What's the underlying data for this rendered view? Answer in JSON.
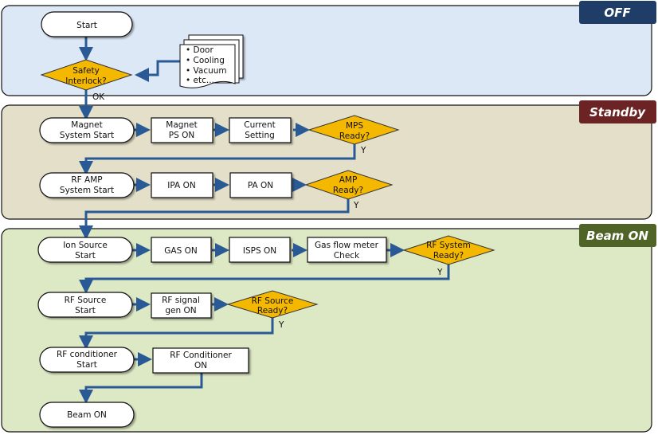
{
  "phases": [
    {
      "id": "off",
      "label": "OFF",
      "bg": "#dde8f7",
      "badge_color": "#1f3d66"
    },
    {
      "id": "standby",
      "label": "Standby",
      "bg": "#e3dfc8",
      "badge_color": "#6b2323"
    },
    {
      "id": "beam",
      "label": "Beam ON",
      "bg": "#dde8c4",
      "badge_color": "#4f6426"
    }
  ],
  "nodes": {
    "start": [
      "Start"
    ],
    "safety": [
      "Safety",
      "Interlock?"
    ],
    "interlock_list": [
      "• Door",
      "• Cooling",
      "• Vacuum",
      "• etc..."
    ],
    "magnet_start": [
      "Magnet",
      "System Start"
    ],
    "magnet_ps": [
      "Magnet",
      "PS ON"
    ],
    "current_setting": [
      "Current",
      "Setting"
    ],
    "mps_ready": [
      "MPS",
      "Ready?"
    ],
    "rfamp_start": [
      "RF AMP",
      "System Start"
    ],
    "ipa_on": [
      "IPA ON"
    ],
    "pa_on": [
      "PA ON"
    ],
    "amp_ready": [
      "AMP",
      "Ready?"
    ],
    "ion_start": [
      "Ion Source",
      "Start"
    ],
    "gas_on": [
      "GAS ON"
    ],
    "isps_on": [
      "ISPS ON"
    ],
    "gasflow": [
      "Gas flow meter",
      "Check"
    ],
    "rfsys_ready": [
      "RF System",
      "Ready?"
    ],
    "rfsrc_start": [
      "RF Source",
      "Start"
    ],
    "rfsig_on": [
      "RF signal",
      "gen ON"
    ],
    "rfsrc_ready": [
      "RF Source",
      "Ready?"
    ],
    "rfcond_start": [
      "RF conditioner",
      "Start"
    ],
    "rfcond_on": [
      "RF Conditioner",
      "ON"
    ],
    "beam_on": [
      "Beam ON"
    ]
  },
  "edge_labels": {
    "ok": "OK",
    "yes": "Y"
  },
  "colors": {
    "arrow": "#2a5a96",
    "decision": "#f5b800"
  }
}
